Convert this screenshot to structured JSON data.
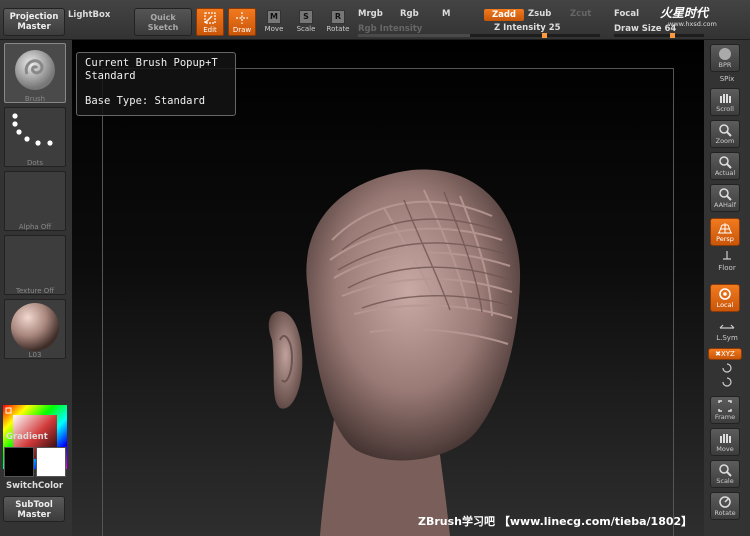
{
  "toolbar": {
    "projection_master": [
      "Projection",
      "Master"
    ],
    "lightbox": "LightBox",
    "quick_sketch": [
      "Quick",
      "Sketch"
    ],
    "tools": [
      {
        "label": "Edit",
        "active": true
      },
      {
        "label": "Draw",
        "active": true
      },
      {
        "label": "Move",
        "active": false,
        "glyph": "M"
      },
      {
        "label": "Scale",
        "active": false,
        "glyph": "S"
      },
      {
        "label": "Rotate",
        "active": false,
        "glyph": "R"
      }
    ],
    "mrgb": "Mrgb",
    "rgb": "Rgb",
    "m": "M",
    "rgb_intensity": "Rgb Intensity",
    "zadd": "Zadd",
    "zsub": "Zsub",
    "zcut": "Zcut",
    "z_intensity": "Z Intensity 25",
    "z_intensity_value": 25,
    "focal": "Focal",
    "draw_size": "Draw Size 64",
    "draw_size_value": 64
  },
  "logo": {
    "name": "火星时代",
    "url": "www.hxsd.com"
  },
  "left": {
    "brush_caption": "Brush",
    "dots_caption": "Dots",
    "alpha_caption": "Alpha Off",
    "texture_caption": "Texture Off",
    "material_caption": "L03",
    "gradient_label": "Gradient",
    "switch_color_label": "SwitchColor",
    "subtool_master": [
      "SubTool",
      "Master"
    ],
    "main_color": "#000000",
    "secondary_color": "#ffffff"
  },
  "popup": {
    "line1": "Current Brush  Popup+T",
    "line2": "Standard",
    "line3": "Base Type: Standard"
  },
  "right": {
    "bpr": "BPR",
    "spix": "SPix",
    "buttons": [
      "Scroll",
      "Zoom",
      "Actual",
      "AAHalf",
      "Persp",
      "Floor",
      "Local",
      "L.Sym",
      "Frame",
      "Move",
      "Scale",
      "Rotate"
    ],
    "xyz": "✖XYZ"
  },
  "watermark": "ZBrush学习吧 【www.linecg.com/tieba/1802】",
  "colors": {
    "accent": "#f27a1f",
    "panel": "#333333"
  }
}
